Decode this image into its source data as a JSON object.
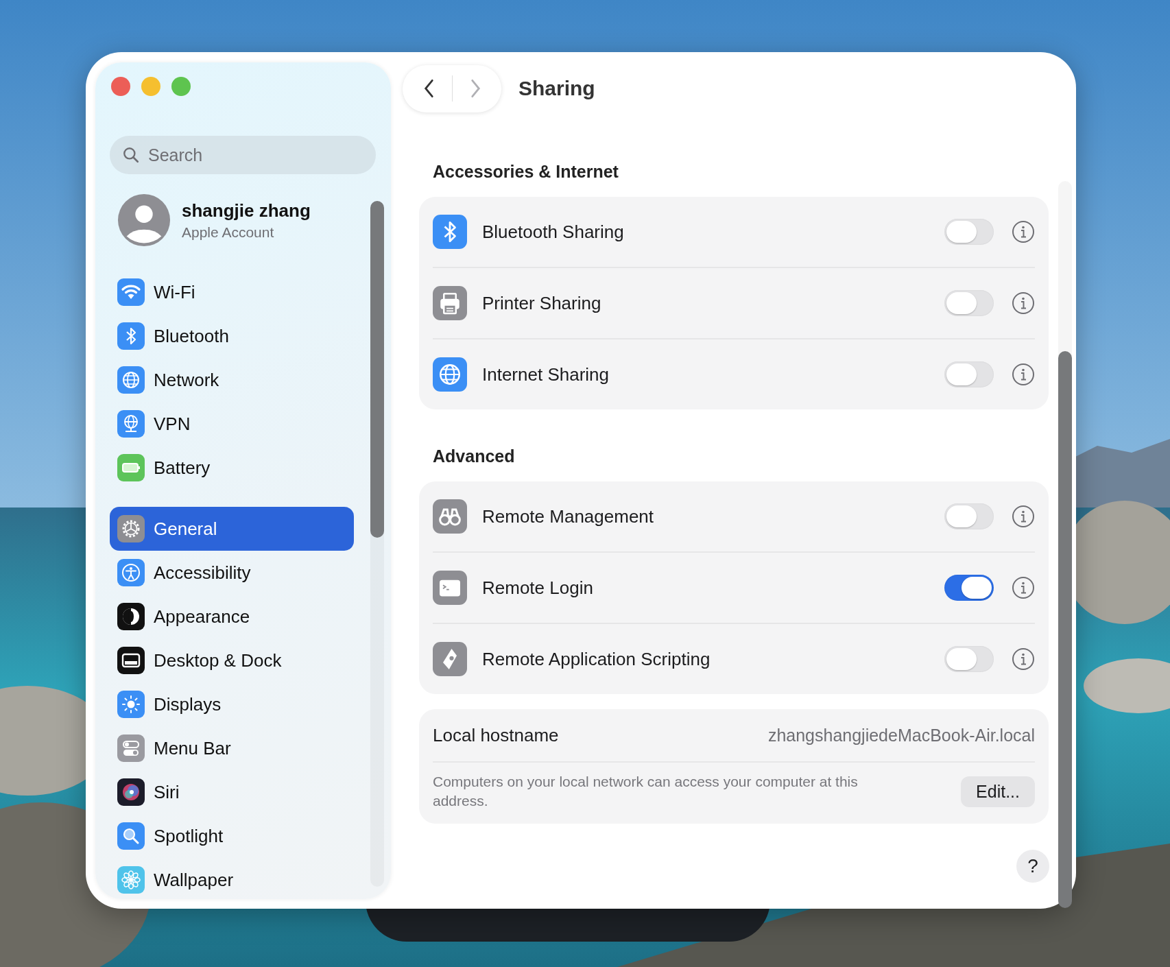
{
  "window": {
    "title": "Sharing"
  },
  "nav": {
    "back": {
      "disabled": false
    },
    "forward": {
      "disabled": true
    }
  },
  "search": {
    "placeholder": "Search"
  },
  "account": {
    "name": "shangjie zhang",
    "subtitle": "Apple Account"
  },
  "sidebar": {
    "groups": [
      [
        {
          "label": "Wi-Fi",
          "selected": false
        },
        {
          "label": "Bluetooth",
          "selected": false
        },
        {
          "label": "Network",
          "selected": false
        },
        {
          "label": "VPN",
          "selected": false
        },
        {
          "label": "Battery",
          "selected": false
        }
      ],
      [
        {
          "label": "General",
          "selected": true
        },
        {
          "label": "Accessibility",
          "selected": false
        },
        {
          "label": "Appearance",
          "selected": false
        },
        {
          "label": "Desktop & Dock",
          "selected": false
        },
        {
          "label": "Displays",
          "selected": false
        },
        {
          "label": "Menu Bar",
          "selected": false
        },
        {
          "label": "Siri",
          "selected": false
        },
        {
          "label": "Spotlight",
          "selected": false
        },
        {
          "label": "Wallpaper",
          "selected": false
        }
      ]
    ]
  },
  "sections": [
    {
      "title": "Accessories & Internet",
      "rows": [
        {
          "label": "Bluetooth Sharing",
          "on": false
        },
        {
          "label": "Printer Sharing",
          "on": false
        },
        {
          "label": "Internet Sharing",
          "on": false
        }
      ]
    },
    {
      "title": "Advanced",
      "rows": [
        {
          "label": "Remote Management",
          "on": false
        },
        {
          "label": "Remote Login",
          "on": true
        },
        {
          "label": "Remote Application Scripting",
          "on": false
        }
      ]
    }
  ],
  "hostname": {
    "label": "Local hostname",
    "value": "zhangshangjiedeMacBook-Air.local",
    "note": "Computers on your local network can access your computer at this address.",
    "button": "Edit..."
  },
  "help": "?"
}
